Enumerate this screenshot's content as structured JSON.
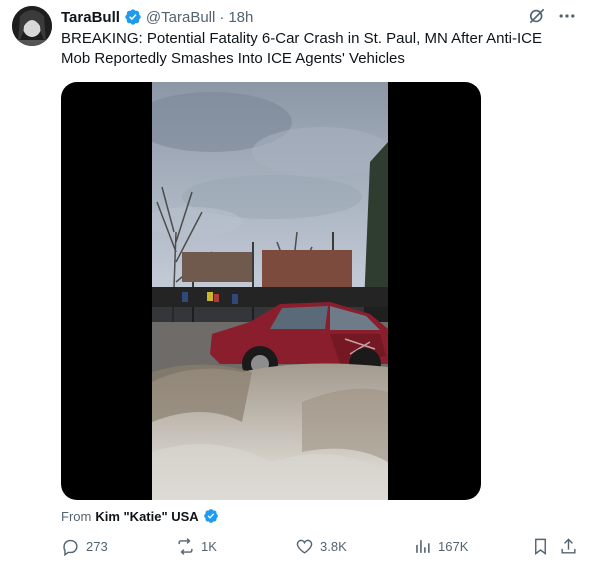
{
  "author": {
    "name": "TaraBull",
    "handle": "@TaraBull",
    "separator": "·",
    "time": "18h"
  },
  "tweet": {
    "text": "BREAKING: Potential Fatality 6-Car Crash in St. Paul, MN After Anti-ICE Mob Reportedly Smashes Into ICE Agents' Vehicles"
  },
  "media": {
    "type": "video",
    "scene": "street-crash-crowd"
  },
  "attribution": {
    "prefix": "From",
    "source": "Kim \"Katie\" USA"
  },
  "metrics": {
    "replies": "273",
    "reposts": "1K",
    "likes": "3.8K",
    "views": "167K"
  },
  "colors": {
    "text": "#0f1419",
    "secondary": "#536471",
    "verified": "#1d9bf0",
    "car": "#8a1e2c"
  },
  "icons": {
    "reply": "reply-icon",
    "repost": "repost-icon",
    "like": "heart-icon",
    "views": "views-icon",
    "bookmark": "bookmark-icon",
    "share": "share-icon",
    "grok": "grok-icon",
    "more": "more-icon"
  }
}
